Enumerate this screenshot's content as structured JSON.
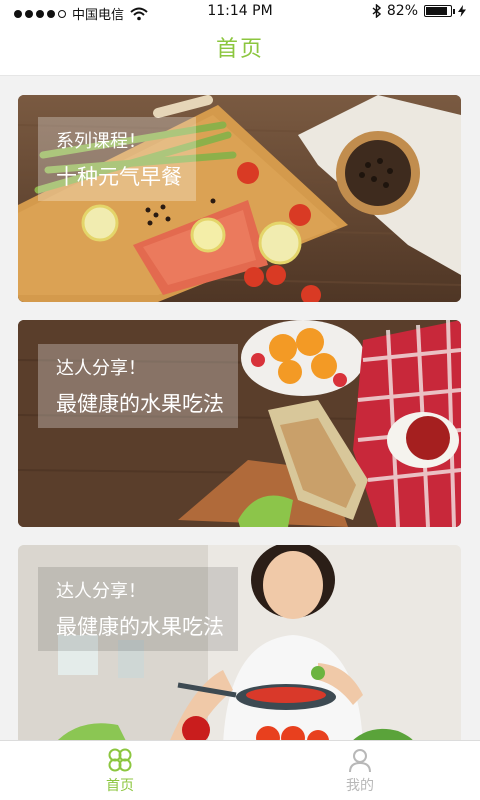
{
  "status_bar": {
    "carrier": "中国电信",
    "time": "11:14 PM",
    "battery": "82%"
  },
  "header": {
    "title": "首页"
  },
  "cards": [
    {
      "subtitle": "系列课程！",
      "title": "十种元气早餐"
    },
    {
      "subtitle": "达人分享！",
      "title": "最健康的水果吃法"
    },
    {
      "subtitle": "达人分享！",
      "title": "最健康的水果吃法"
    }
  ],
  "tabbar": {
    "home_label": "首页",
    "profile_label": "我的",
    "active_color": "#8cc63f",
    "inactive_color": "#b8b8b8"
  }
}
